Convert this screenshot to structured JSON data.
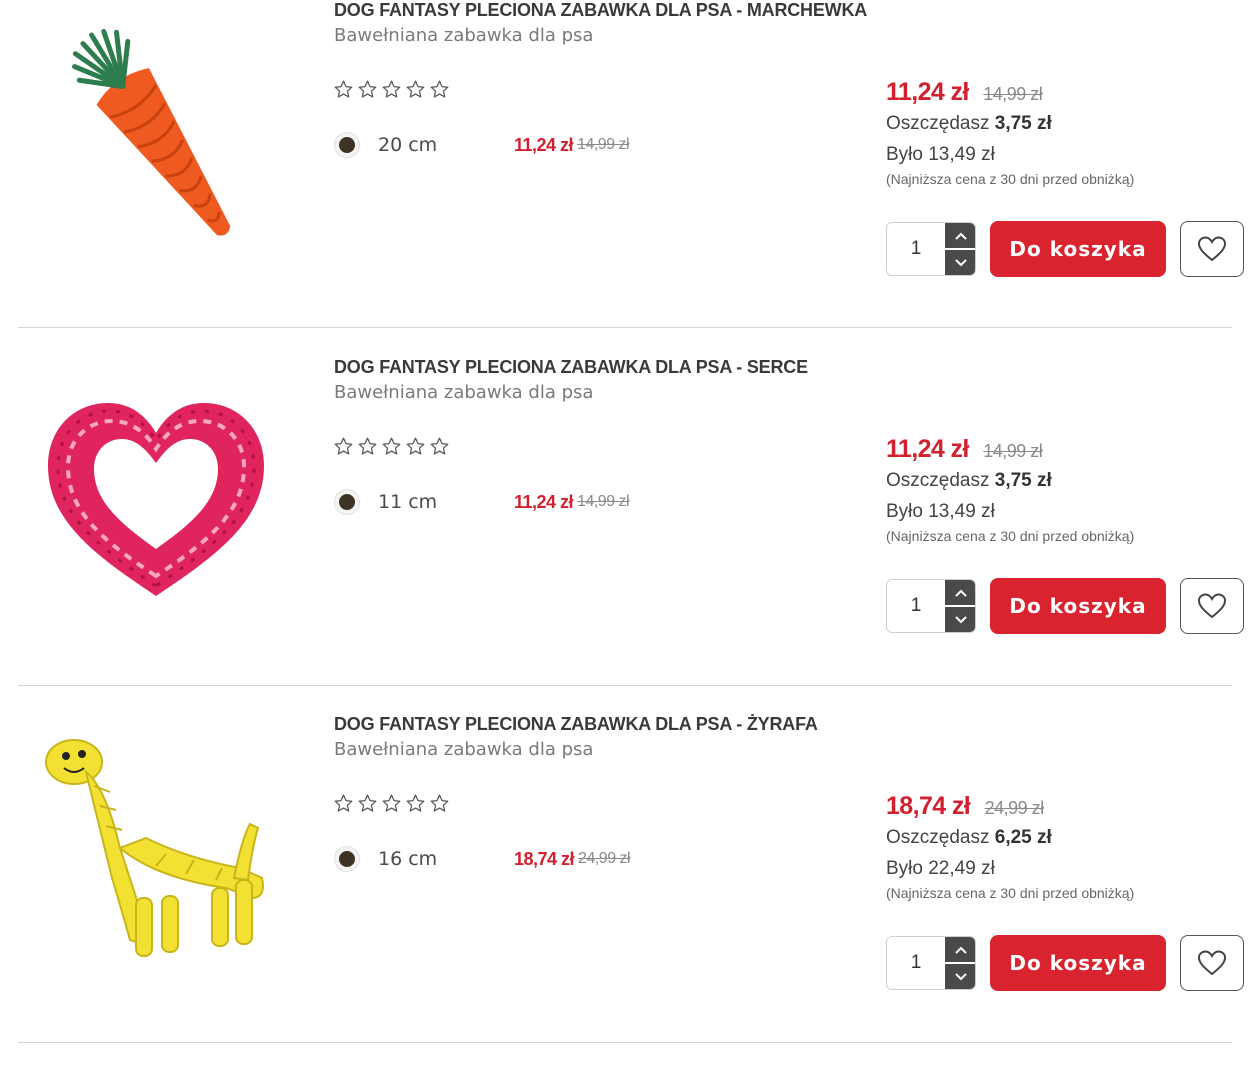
{
  "products": [
    {
      "title": "DOG FANTASY PLECIONA ZABAWKA DLA PSA - MARCHEWKA",
      "subtitle": "Bawełniana zabawka dla psa",
      "image_icon": "carrot-toy-icon",
      "rating_stars": 0,
      "variant": {
        "size": "20 cm",
        "price": "11,24 zł",
        "old_price": "14,99 zł"
      },
      "price": "11,24 zł",
      "old_price": "14,99 zł",
      "savings_label": "Oszczędasz",
      "savings_value": "3,75 zł",
      "was": "Było 13,49 zł",
      "lowest_note": "(Najniższa cena z 30 dni przed obniżką)",
      "quantity": "1",
      "cart_label": "Do koszyka"
    },
    {
      "title": "DOG FANTASY PLECIONA ZABAWKA DLA PSA - SERCE",
      "subtitle": "Bawełniana zabawka dla psa",
      "image_icon": "heart-toy-icon",
      "rating_stars": 0,
      "variant": {
        "size": "11 cm",
        "price": "11,24 zł",
        "old_price": "14,99 zł"
      },
      "price": "11,24 zł",
      "old_price": "14,99 zł",
      "savings_label": "Oszczędasz",
      "savings_value": "3,75 zł",
      "was": "Było 13,49 zł",
      "lowest_note": "(Najniższa cena z 30 dni przed obniżką)",
      "quantity": "1",
      "cart_label": "Do koszyka"
    },
    {
      "title": "DOG FANTASY PLECIONA ZABAWKA DLA PSA - ŻYRAFA",
      "subtitle": "Bawełniana zabawka dla psa",
      "image_icon": "giraffe-toy-icon",
      "rating_stars": 0,
      "variant": {
        "size": "16 cm",
        "price": "18,74 zł",
        "old_price": "24,99 zł"
      },
      "price": "18,74 zł",
      "old_price": "24,99 zł",
      "savings_label": "Oszczędasz",
      "savings_value": "6,25 zł",
      "was": "Było 22,49 zł",
      "lowest_note": "(Najniższa cena z 30 dni przed obniżką)",
      "quantity": "1",
      "cart_label": "Do koszyka"
    }
  ],
  "colors": {
    "accent_red": "#d9232e",
    "price_red": "#d2202e",
    "variant_dot": "#3e3322",
    "stepper": "#4a4a4a"
  }
}
